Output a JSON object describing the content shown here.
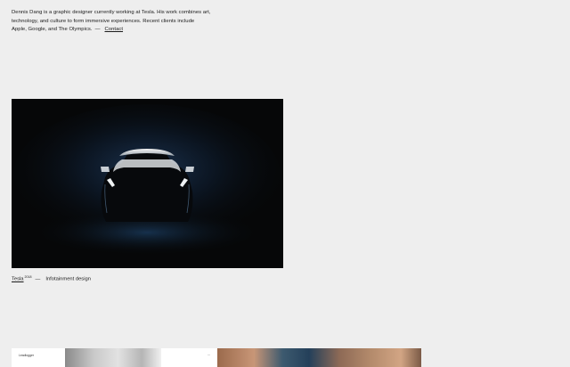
{
  "intro": {
    "line1": "Dennis Dang is a graphic designer currently working at Tesla. His work combines art,",
    "line2": "technology, and culture to form immersive experiences. Recent clients include",
    "line3": "Apple, Google, and The Olympics.",
    "dash": "—",
    "contact_label": "Contact"
  },
  "hero": {
    "project": "Tesla",
    "year": "2018",
    "dash": "—",
    "description": "Infotainment design"
  },
  "thumbs": {
    "left_title": "Leadlogger",
    "left_number": "···"
  },
  "colors": {
    "background": "#eeeeee",
    "text": "#1a1a1a",
    "hero_bg": "#060708",
    "hero_glow": "#1f3a5c"
  }
}
